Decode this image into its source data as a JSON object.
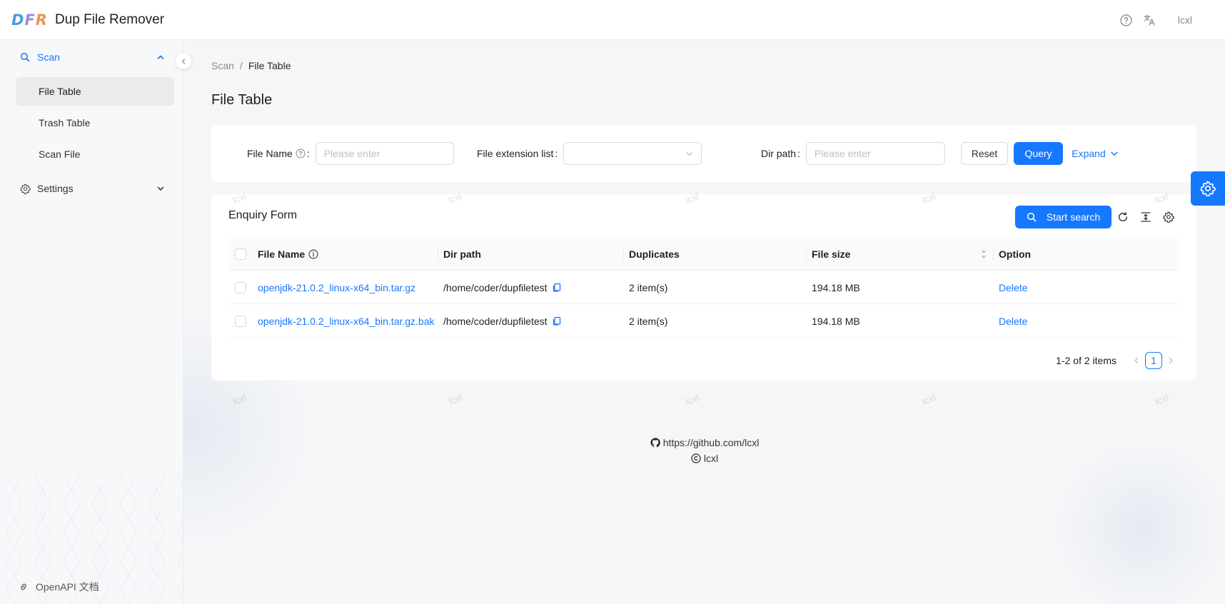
{
  "app": {
    "logo": {
      "l1": "D",
      "l2": "F",
      "l3": "R"
    },
    "title": "Dup File Remover",
    "user": "lcxl"
  },
  "sidebar": {
    "scan": {
      "label": "Scan",
      "icon": "search-icon",
      "expanded": true
    },
    "items": [
      {
        "label": "File Table",
        "active": true
      },
      {
        "label": "Trash Table",
        "active": false
      },
      {
        "label": "Scan File",
        "active": false
      }
    ],
    "settings": {
      "label": "Settings",
      "icon": "gear-icon",
      "expanded": false
    },
    "openapi": {
      "label": "OpenAPI 文档",
      "icon": "link-icon"
    }
  },
  "breadcrumb": {
    "parent": "Scan",
    "sep": "/",
    "current": "File Table"
  },
  "page_title": "File Table",
  "query": {
    "file_name": {
      "label": "File Name",
      "placeholder": "Please enter",
      "value": ""
    },
    "ext_list": {
      "label": "File extension list",
      "value": ""
    },
    "dir_path": {
      "label": "Dir path",
      "placeholder": "Please enter",
      "value": ""
    },
    "colon": ":",
    "reset_label": "Reset",
    "query_label": "Query",
    "expand_label": "Expand"
  },
  "table_card": {
    "title": "Enquiry Form",
    "start_search_label": "Start search",
    "columns": {
      "name": "File Name",
      "dir": "Dir path",
      "dup": "Duplicates",
      "size": "File size",
      "option": "Option"
    },
    "rows": [
      {
        "name": "openjdk-21.0.2_linux-x64_bin.tar.gz",
        "dir": "/home/coder/dupfiletest",
        "dup": "2 item(s)",
        "size": "194.18 MB",
        "option": "Delete"
      },
      {
        "name": "openjdk-21.0.2_linux-x64_bin.tar.gz.bak",
        "dir": "/home/coder/dupfiletest",
        "dup": "2 item(s)",
        "size": "194.18 MB",
        "option": "Delete"
      }
    ],
    "pagination": {
      "total_text": "1-2 of 2 items",
      "current": "1"
    }
  },
  "watermark": "lcxl",
  "footer": {
    "link": "https://github.com/lcxl",
    "copyright": "lcxl"
  },
  "colors": {
    "primary": "#1677ff",
    "bg": "#f5f6f8",
    "logo_d": "#4b9be6",
    "logo_f": "#9b8ed9",
    "logo_r": "#e8965a"
  }
}
